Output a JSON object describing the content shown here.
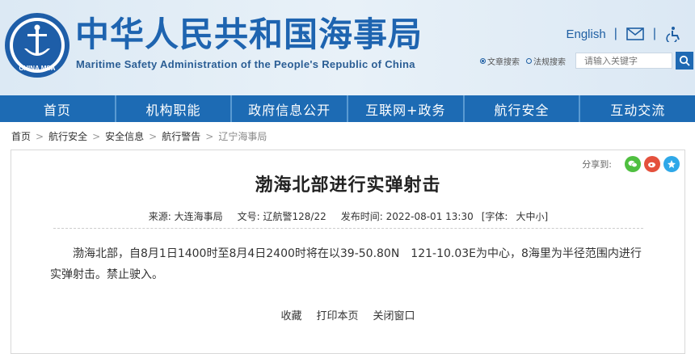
{
  "header": {
    "title_cn": "中华人民共和国海事局",
    "title_en": "Maritime Safety Administration of the People's Republic of China",
    "logo_text": "CHINA MSA",
    "english_link": "English",
    "separator": "|",
    "search_options": [
      "文章搜索",
      "法规搜索"
    ],
    "search_placeholder": "请输入关键字",
    "brand_color": "#1e64b0"
  },
  "nav": {
    "items": [
      "首页",
      "机构职能",
      "政府信息公开",
      "互联网+政务",
      "航行安全",
      "互动交流"
    ],
    "bg_color": "#1d6bb4"
  },
  "breadcrumb": {
    "items": [
      "首页",
      "航行安全",
      "安全信息",
      "航行警告",
      "辽宁海事局"
    ],
    "separator": ">"
  },
  "share": {
    "label": "分享到:"
  },
  "article": {
    "title": "渤海北部进行实弹射击",
    "source": "来源: 大连海事局",
    "doc_no": "文号: 辽航警128/22",
    "publish_time": "发布时间: 2022-08-01 13:30",
    "font_label": "[字体:",
    "font_sizes": [
      "大",
      "中",
      "小"
    ],
    "font_close": "]",
    "body": "渤海北部，自8月1日1400时至8月4日2400时将在以39-50.80N　121-10.03E为中心，8海里为半径范围内进行实弹射击。禁止驶入。"
  },
  "actions": [
    "收藏",
    "打印本页",
    "关闭窗口"
  ]
}
